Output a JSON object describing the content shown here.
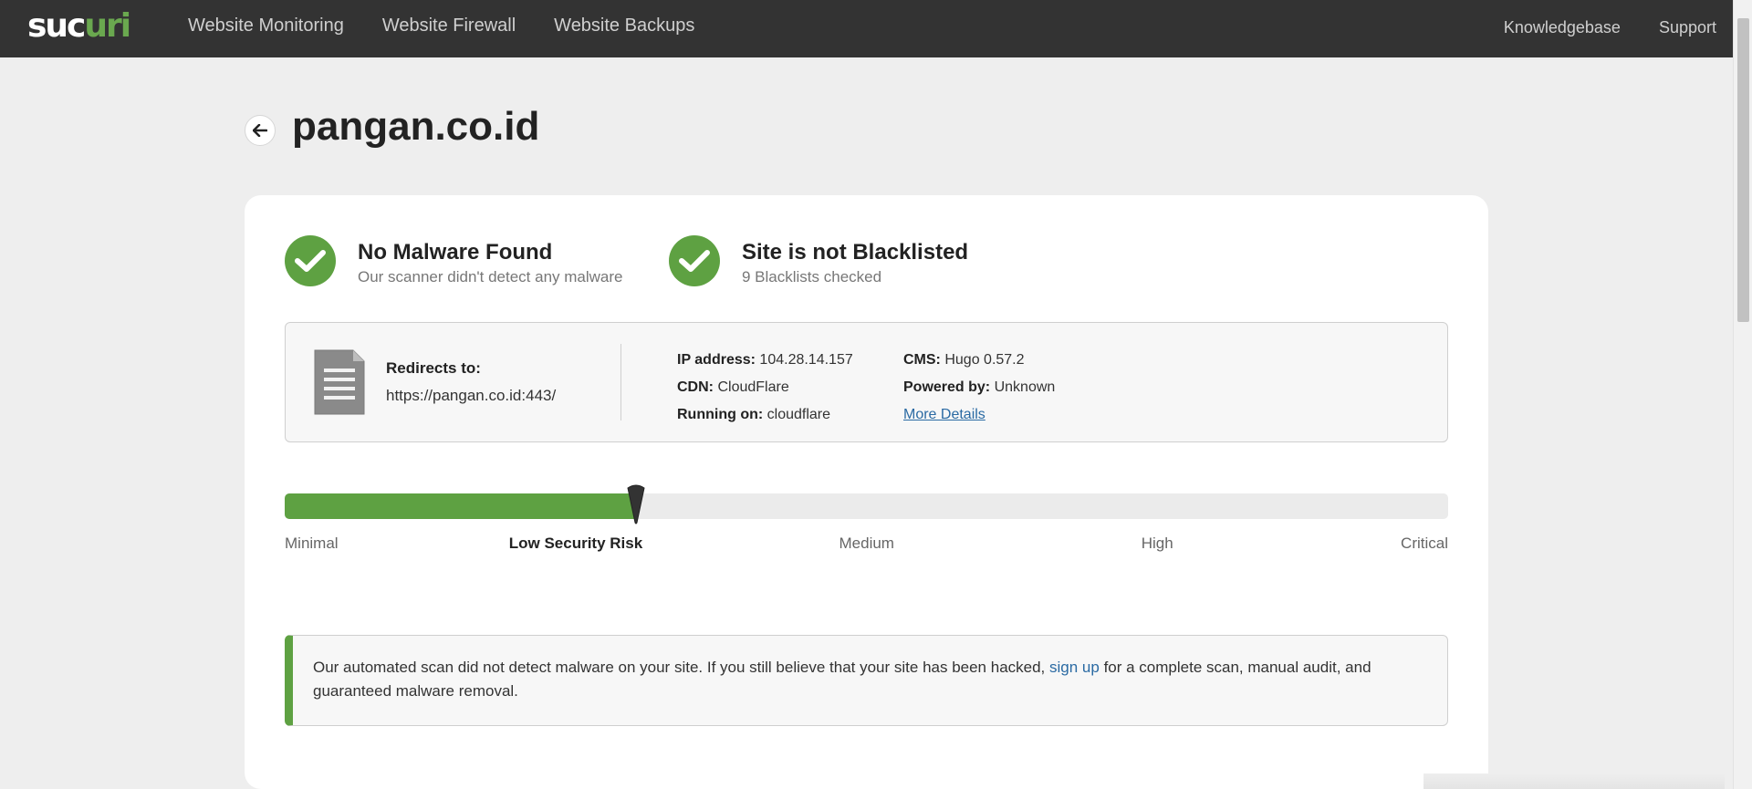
{
  "nav": {
    "logo_main": "suc",
    "logo_rest": "uri",
    "left": [
      "Website Monitoring",
      "Website Firewall",
      "Website Backups"
    ],
    "right": [
      "Knowledgebase",
      "Support"
    ]
  },
  "page": {
    "back_icon": "arrow-left-icon",
    "title": "pangan.co.id"
  },
  "status": [
    {
      "icon": "check-circle-icon",
      "head": "No Malware Found",
      "sub": "Our scanner didn't detect any malware"
    },
    {
      "icon": "check-circle-icon",
      "head": "Site is not Blacklisted",
      "sub": "9 Blacklists checked"
    }
  ],
  "info": {
    "redirect_label": "Redirects to:",
    "redirect_url": "https://pangan.co.id:443/",
    "ip_label": "IP address:",
    "ip_value": "104.28.14.157",
    "cdn_label": "CDN:",
    "cdn_value": "CloudFlare",
    "running_label": "Running on:",
    "running_value": "cloudflare",
    "cms_label": "CMS:",
    "cms_value": "Hugo 0.57.2",
    "powered_label": "Powered by:",
    "powered_value": "Unknown",
    "more_details": "More Details"
  },
  "risk": {
    "level_fraction": 0.302,
    "labels": [
      "Minimal",
      "Low Security Risk",
      "Medium",
      "High",
      "Critical"
    ],
    "active_index": 1,
    "fill_color": "#5ea142"
  },
  "notice": {
    "before": "Our automated scan did not detect malware on your site. If you still believe that your site has been hacked, ",
    "link": "sign up",
    "after": " for a complete scan, manual audit, and guaranteed malware removal."
  },
  "colors": {
    "accent_green": "#5ea142",
    "nav_bg": "#333333",
    "link_blue": "#2a6aa3"
  }
}
